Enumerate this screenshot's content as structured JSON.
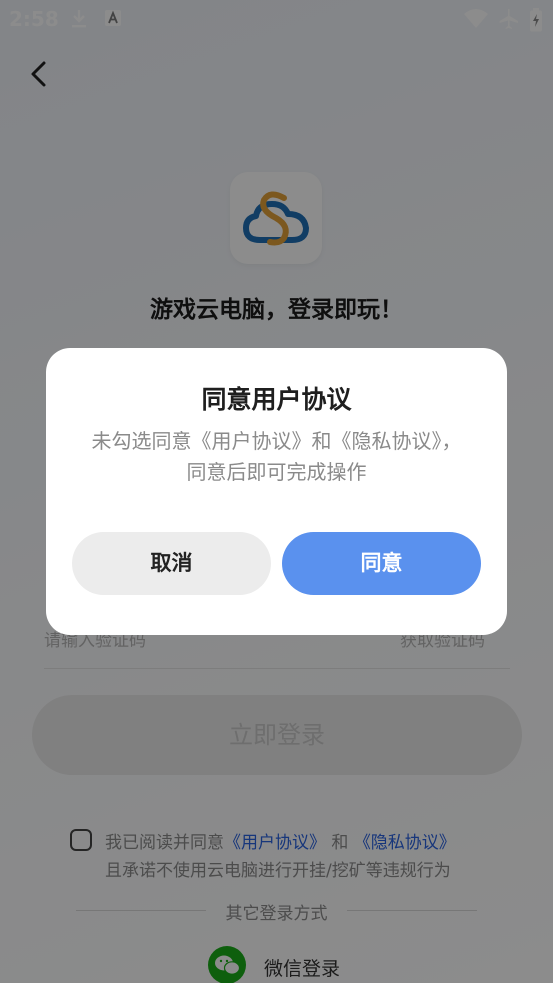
{
  "status_bar": {
    "time": "2:58",
    "icons": [
      "download-icon",
      "a-badge-icon",
      "wifi-icon",
      "airplane-icon",
      "battery-charging-icon"
    ]
  },
  "header": {
    "back_icon": "chevron-left-icon"
  },
  "app": {
    "logo_icon": "cloud-logo-icon",
    "title": "游戏云电脑，登录即玩！"
  },
  "form": {
    "code_placeholder": "请输入验证码",
    "get_code_label": "获取验证码",
    "login_button_label": "立即登录"
  },
  "agreement": {
    "prefix": "我已阅读并同意",
    "user_agreement_link": "《用户协议》",
    "and": "和",
    "privacy_link": "《隐私协议》",
    "line2": "且承诺不使用云电脑进行开挂/挖矿等违规行为"
  },
  "other_login": {
    "title": "其它登录方式",
    "wechat_label": "微信登录"
  },
  "dialog": {
    "title": "同意用户协议",
    "message": "未勾选同意《用户协议》和《隐私协议》，同意后即可完成操作",
    "cancel_label": "取消",
    "agree_label": "同意"
  },
  "colors": {
    "accent": "#5a91ee",
    "link": "#2b63e0",
    "wechat": "#1aad19"
  }
}
